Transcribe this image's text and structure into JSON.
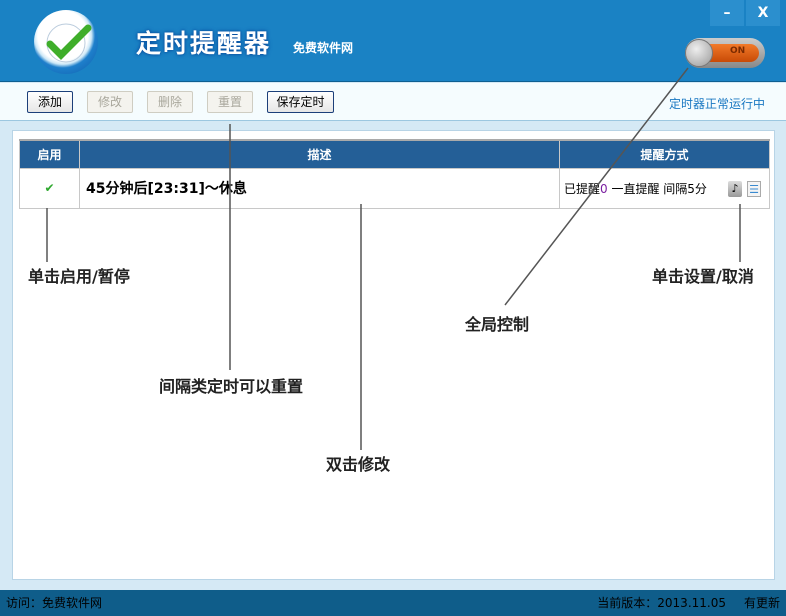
{
  "title": "定时提醒器",
  "subtitle": "免费软件网",
  "window": {
    "minimize": "–",
    "close": "X"
  },
  "toggle": {
    "label": "ON",
    "state": "on"
  },
  "toolbar": {
    "add": "添加",
    "edit": "修改",
    "delete": "删除",
    "reset": "重置",
    "save": "保存定时",
    "status": "定时器正常运行中"
  },
  "table": {
    "headers": [
      "启用",
      "描述",
      "提醒方式"
    ],
    "rows": [
      {
        "enabled": "✔",
        "description": "45分钟后[23:31]～休息",
        "mode_prefix": "已提醒",
        "count": "0",
        "mode_rest": " 一直提醒 间隔5分"
      }
    ]
  },
  "annotations": {
    "toggle_enable": "单击启用/暂停",
    "reset": "间隔类定时可以重置",
    "edit": "双击修改",
    "global": "全局控制",
    "settings": "单击设置/取消"
  },
  "statusbar": {
    "visit": "访问：免费软件网",
    "version": "当前版本：2013.11.05",
    "update": "有更新"
  },
  "colors": {
    "titlebar": "#1a82c4",
    "header": "#245f97",
    "statusbar": "#0f5d8a"
  }
}
